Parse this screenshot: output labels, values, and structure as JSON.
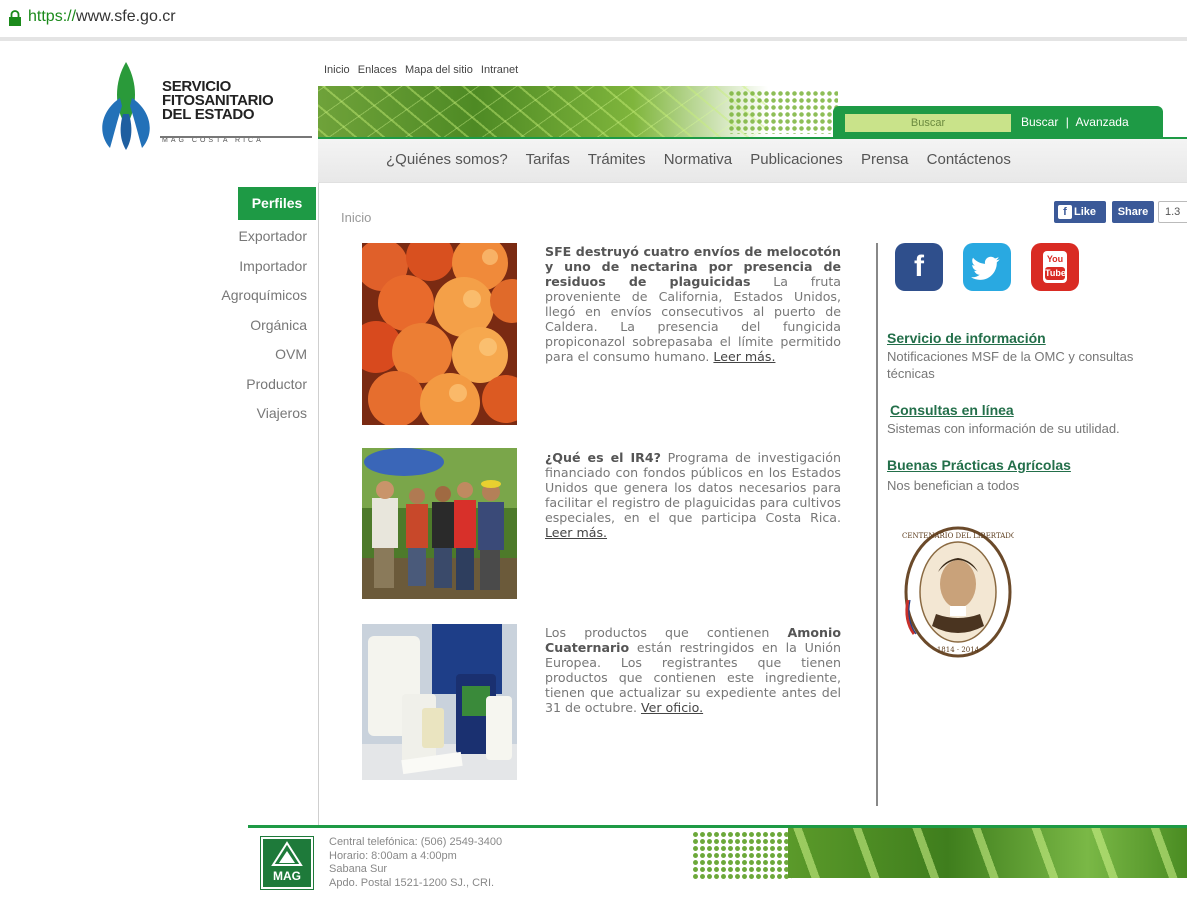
{
  "browser": {
    "url_scheme": "https://",
    "url_rest": "www.sfe.go.cr"
  },
  "logo": {
    "line1": "SERVICIO",
    "line2": "FITOSANITARIO",
    "line3": "DEL ESTADO",
    "tagline": "MAG COSTA RICA"
  },
  "topnav": [
    "Inicio",
    "Enlaces",
    "Mapa del sitio",
    "Intranet"
  ],
  "search": {
    "placeholder": "Buscar",
    "button": "Buscar",
    "sep": "|",
    "advanced": "Avanzada"
  },
  "mainmenu": [
    "¿Quiénes somos?",
    "Tarifas",
    "Trámites",
    "Normativa",
    "Publicaciones",
    "Prensa",
    "Contáctenos"
  ],
  "sidebar": {
    "title": "Perfiles",
    "items": [
      "Exportador",
      "Importador",
      "Agroquímicos",
      "Orgánica",
      "OVM",
      "Productor",
      "Viajeros"
    ]
  },
  "breadcrumb": "Inicio",
  "facebook": {
    "like": "Like",
    "share": "Share",
    "count": "1.3"
  },
  "articles": [
    {
      "bold": "SFE destruyó cuatro envíos de melocotón y uno de nectarina por presencia de residuos de plaguicidas",
      "text": " La fruta proveniente de California, Estados Unidos, llegó en envíos consecutivos al puerto de Caldera. La presencia del fungicida propiconazol sobrepasaba el límite permitido para el consumo humano. ",
      "more": "Leer más."
    },
    {
      "bold": "¿Qué es el IR4?",
      "text": " Programa de investigación financiado con fondos públicos en los Estados Unidos que genera los datos necesarios para facilitar el registro de plaguicidas para cultivos especiales, en el que participa Costa Rica. ",
      "more": "Leer más."
    },
    {
      "pre": "Los productos que contienen ",
      "bold": "Amonio Cuaternario",
      "text": " están restringidos en la Unión Europea. Los registrantes que tienen productos que contienen este ingrediente, tienen que actualizar su expediente antes del 31 de octubre. ",
      "more": "Ver oficio."
    }
  ],
  "social": {
    "facebook": "f",
    "youtube_top": "You",
    "youtube_bottom": "Tube"
  },
  "right_links": [
    {
      "title": "Servicio de información",
      "desc": "Notificaciones MSF de la OMC y consultas técnicas"
    },
    {
      "title": "Consultas en línea",
      "desc": "Sistemas con información de su utilidad."
    },
    {
      "title": "Buenas Prácticas Agrícolas",
      "desc": "Nos benefician a todos"
    }
  ],
  "footer": {
    "mag_label": "MAG",
    "lines": [
      "Central telefónica: (506) 2549-3400",
      "Horario: 8:00am a 4:00pm",
      "Sabana Sur",
      "Apdo. Postal 1521-1200 SJ., CRI."
    ]
  },
  "colors": {
    "brand_green": "#1e9a45",
    "link_green": "#236f4a",
    "facebook": "#3b5998",
    "twitter": "#29a9e1",
    "youtube": "#d92b23"
  }
}
